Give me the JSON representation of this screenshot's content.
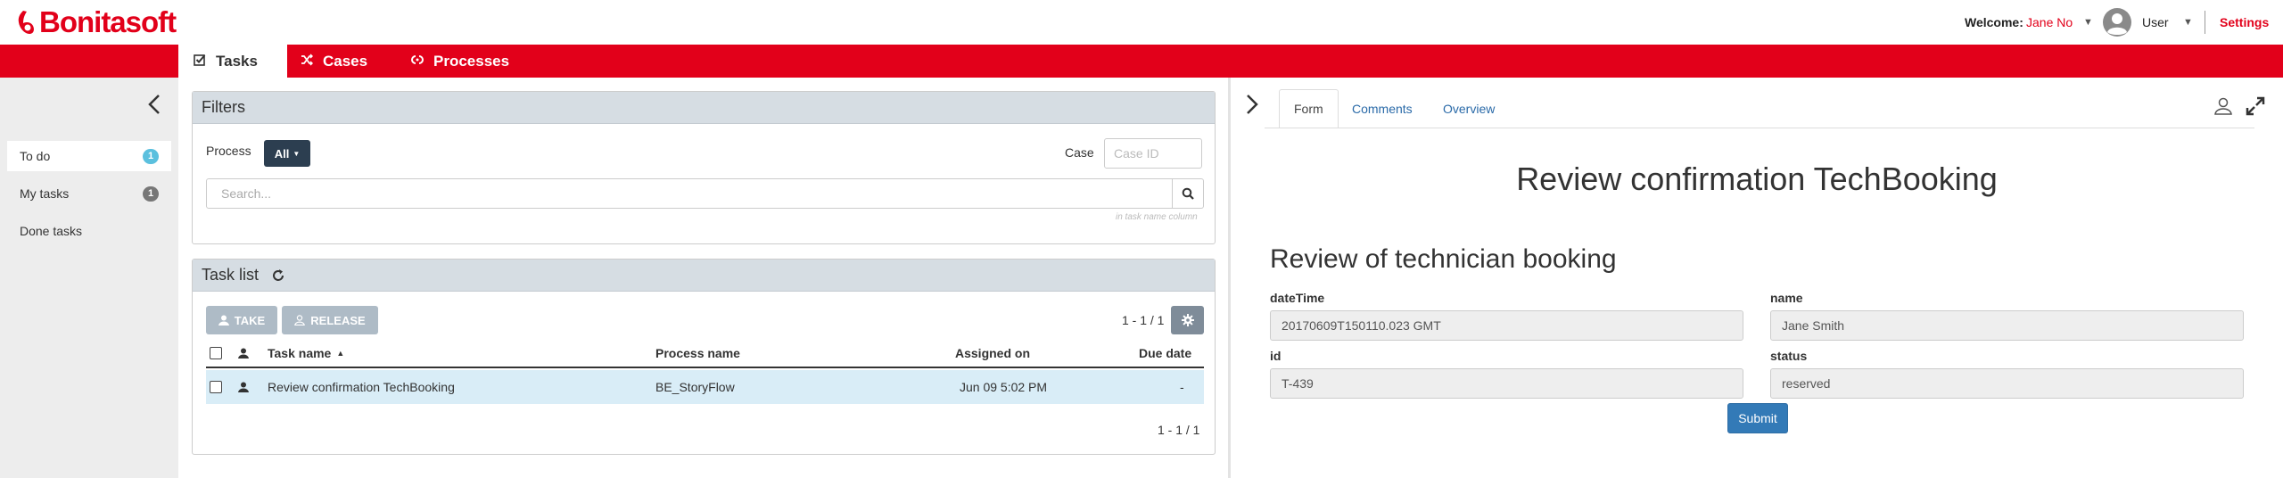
{
  "header": {
    "logo_text": "Bonitasoft",
    "welcome_label": "Welcome:",
    "welcome_name": "Jane No",
    "user_label": "User",
    "settings_label": "Settings"
  },
  "nav": {
    "tabs": [
      {
        "label": "Tasks",
        "icon": "check-square-icon"
      },
      {
        "label": "Cases",
        "icon": "shuffle-icon"
      },
      {
        "label": "Processes",
        "icon": "cogs-icon"
      }
    ]
  },
  "sidebar": {
    "items": [
      {
        "label": "To do",
        "badge": "1",
        "active": true
      },
      {
        "label": "My tasks",
        "badge": "1"
      },
      {
        "label": "Done tasks"
      }
    ]
  },
  "filters": {
    "title": "Filters",
    "process_label": "Process",
    "process_value": "All",
    "case_label": "Case",
    "case_placeholder": "Case ID",
    "search_placeholder": "Search...",
    "search_hint": "in task name column"
  },
  "tasklist": {
    "title": "Task list",
    "take_label": "TAKE",
    "release_label": "RELEASE",
    "count_top": "1 - 1 / 1",
    "count_bottom": "1 - 1 / 1",
    "columns": {
      "name": "Task name",
      "process": "Process name",
      "assigned": "Assigned on",
      "due": "Due date"
    },
    "rows": [
      {
        "name": "Review confirmation TechBooking",
        "process": "BE_StoryFlow",
        "assigned": "Jun 09 5:02 PM",
        "due": "-"
      }
    ]
  },
  "detail": {
    "tabs": [
      "Form",
      "Comments",
      "Overview"
    ],
    "form_title": "Review confirmation TechBooking",
    "form_subtitle": "Review of technician booking",
    "fields": {
      "dateTime": {
        "label": "dateTime",
        "value": "20170609T150110.023 GMT"
      },
      "name": {
        "label": "name",
        "value": "Jane Smith"
      },
      "id": {
        "label": "id",
        "value": "T-439"
      },
      "status": {
        "label": "status",
        "value": "reserved"
      }
    },
    "submit_label": "Submit"
  },
  "colors": {
    "brand_red": "#e2001a",
    "panel_header": "#d6dde3",
    "badge_blue": "#5bc0de",
    "badge_gray": "#777777",
    "selected_row": "#d9edf7",
    "primary_button": "#337ab7"
  }
}
